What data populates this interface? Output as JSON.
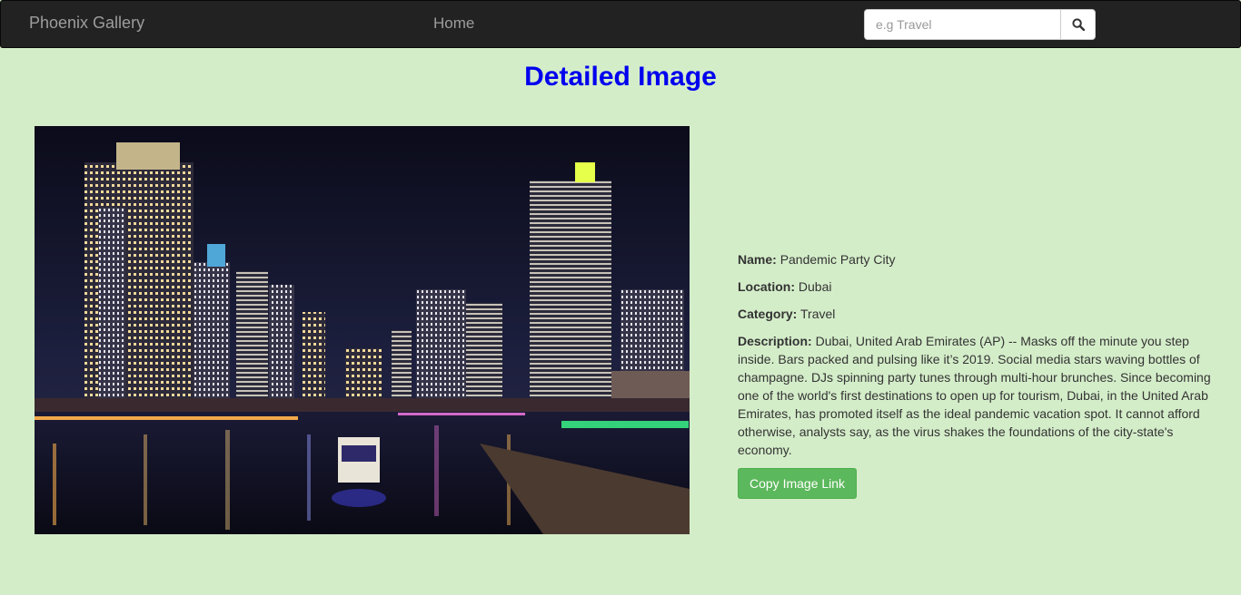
{
  "navbar": {
    "brand": "Phoenix Gallery",
    "home_label": "Home",
    "search_placeholder": "e.g Travel"
  },
  "page": {
    "title": "Detailed Image"
  },
  "image": {
    "name_label": "Name:",
    "name": "Pandemic Party City",
    "location_label": "Location:",
    "location": "Dubai",
    "category_label": "Category:",
    "category": "Travel",
    "description_label": "Description:",
    "description": "Dubai, United Arab Emirates (AP) -- Masks off the minute you step inside. Bars packed and pulsing like it’s 2019. Social media stars waving bottles of champagne. DJs spinning party tunes through multi-hour brunches. Since becoming one of the world's first destinations to open up for tourism, Dubai, in the United Arab Emirates, has promoted itself as the ideal pandemic vacation spot. It cannot afford otherwise, analysts say, as the virus shakes the foundations of the city-state's economy.",
    "copy_button": "Copy Image Link"
  },
  "colors": {
    "page_bg": "#d4edc9",
    "navbar_bg": "#222222",
    "title": "#0000ee",
    "button": "#5cb85c"
  }
}
